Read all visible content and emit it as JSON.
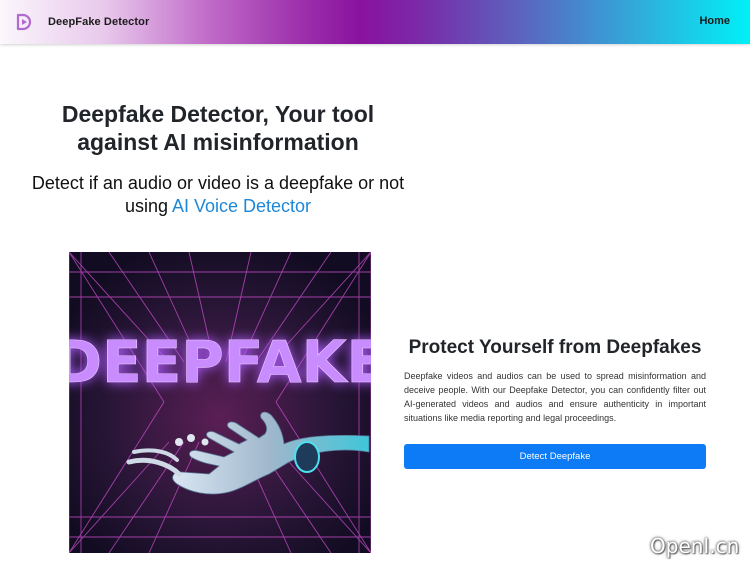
{
  "navbar": {
    "brand_name": "DeepFake Detector",
    "logo_icon": "play-d-logo-icon",
    "home_label": "Home"
  },
  "hero": {
    "title": "Deepfake Detector, Your tool against AI misinformation",
    "subtitle_prefix": "Detect if an audio or video is a deepfake or not using ",
    "subtitle_link": "AI Voice Detector"
  },
  "image": {
    "text": "DEEPFAKE"
  },
  "protect": {
    "title": "Protect Yourself from Deepfakes",
    "body": "Deepfake videos and audios can be used to spread misinformation and deceive people. With our Deepfake Detector, you can confidently filter out AI-generated videos and audios and ensure authenticity in important situations like media reporting and legal proceedings.",
    "button_label": "Detect Deepfake"
  },
  "watermark": {
    "text": "OpenI.cn"
  },
  "colors": {
    "button": "#0d7bf5",
    "link": "#1e88d8",
    "neon_text": "#c98cff"
  }
}
